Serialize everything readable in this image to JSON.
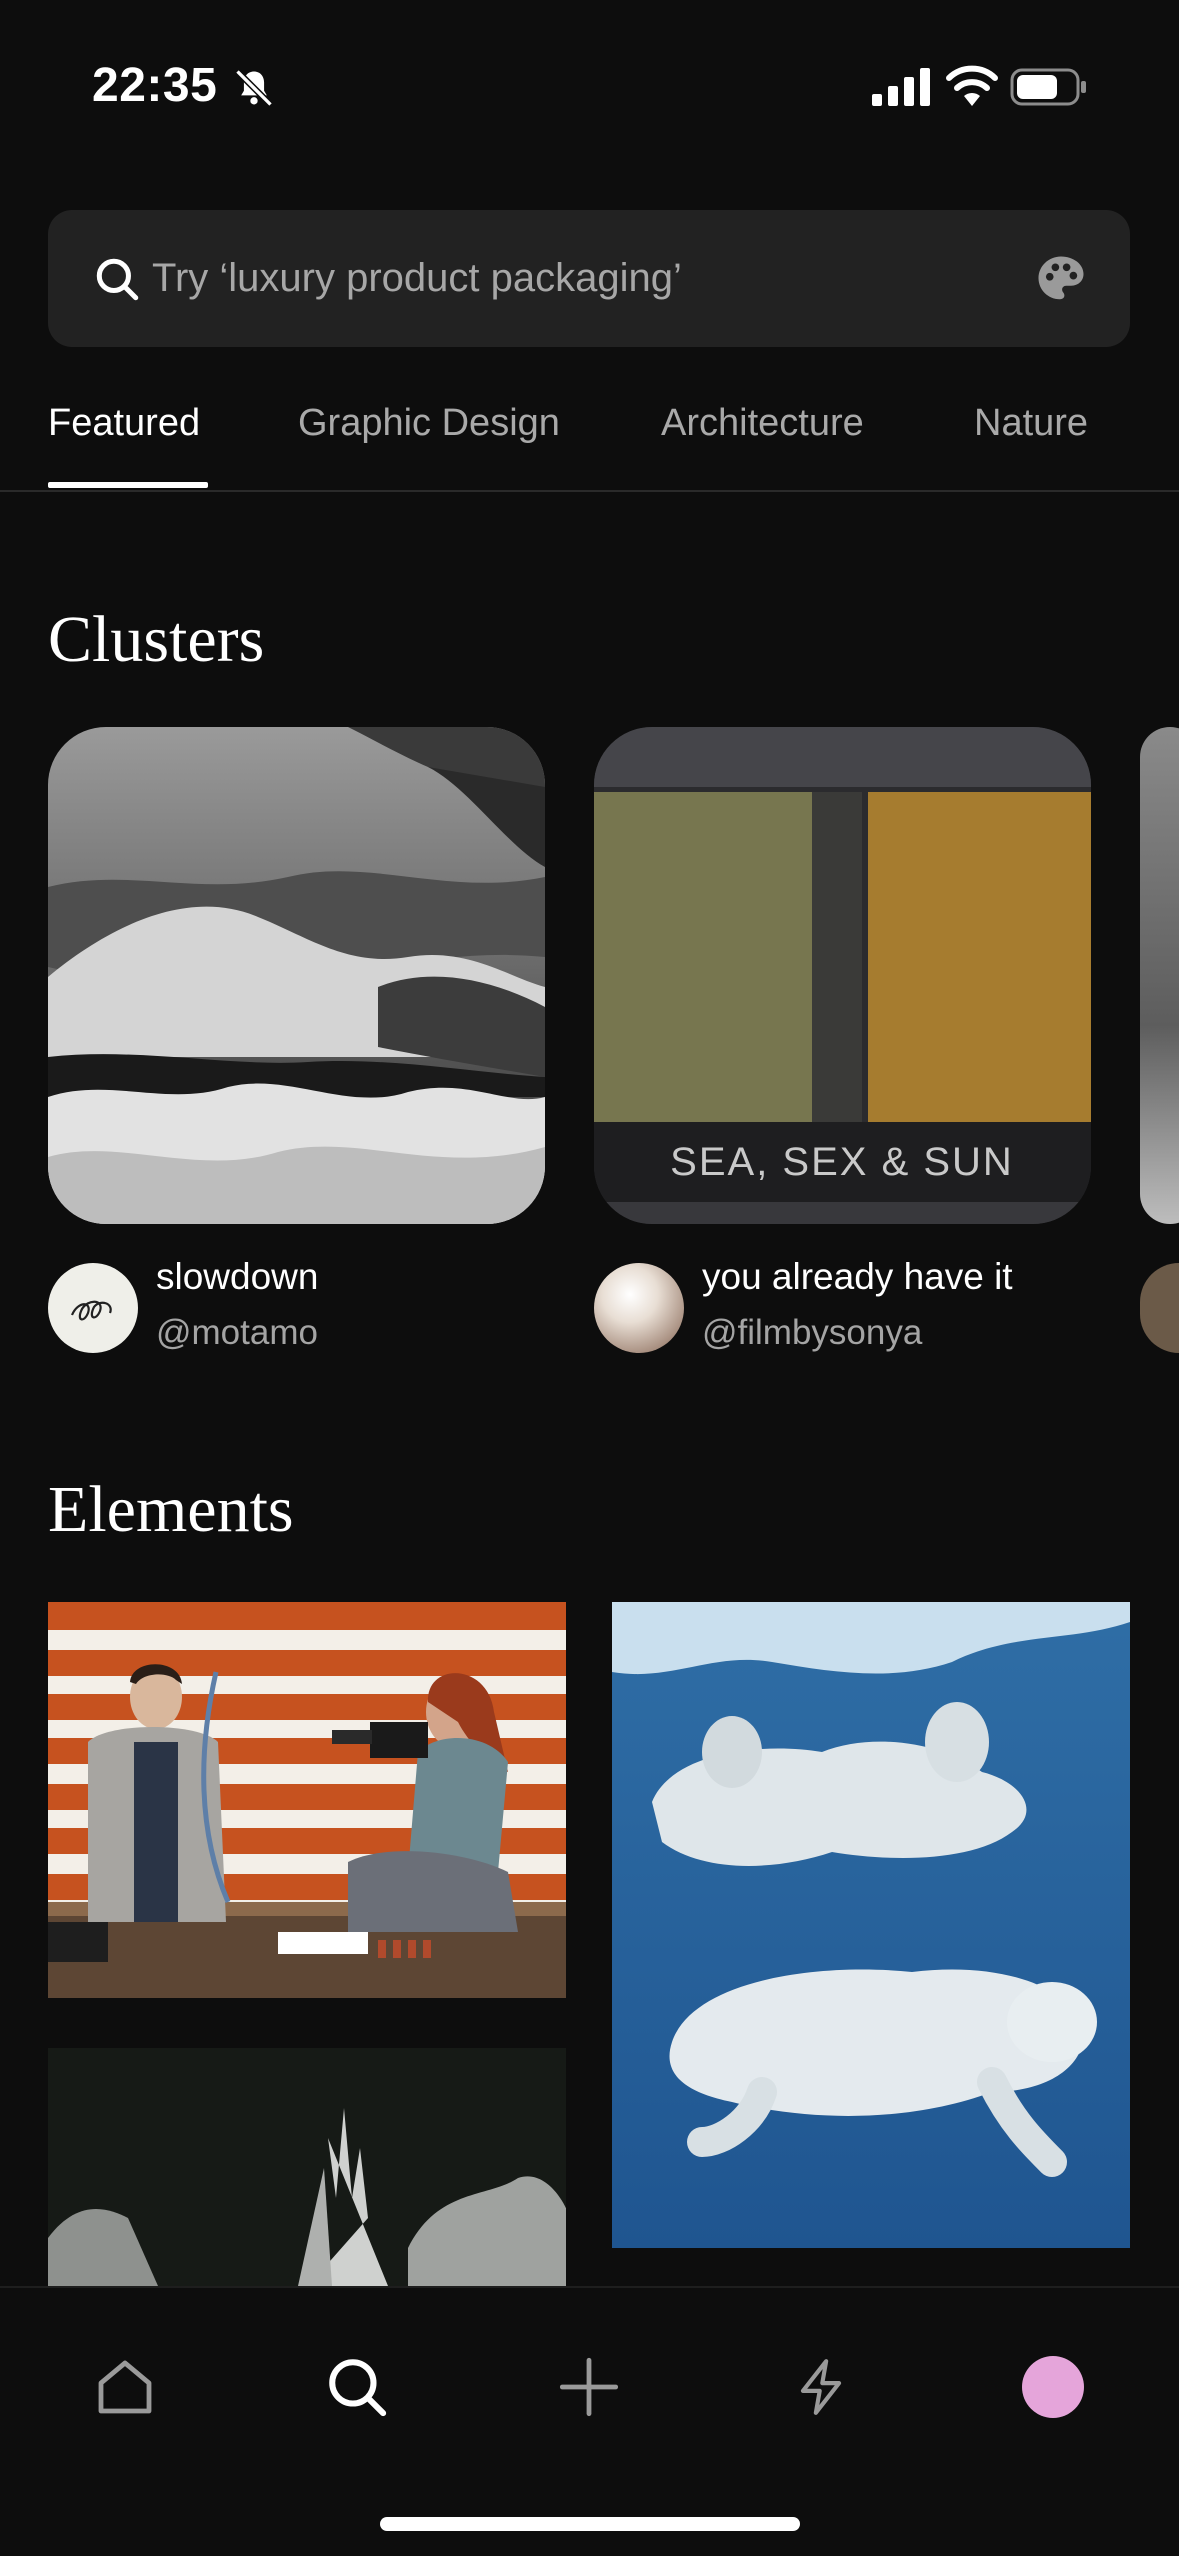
{
  "status_bar": {
    "time": "22:35"
  },
  "search": {
    "placeholder": "Try ‘luxury product packaging’"
  },
  "tabs": [
    {
      "label": "Featured",
      "active": true
    },
    {
      "label": "Graphic Design",
      "active": false
    },
    {
      "label": "Architecture",
      "active": false
    },
    {
      "label": "Nature",
      "active": false
    }
  ],
  "sections": {
    "clusters_title": "Clusters",
    "elements_title": "Elements"
  },
  "clusters": [
    {
      "title": "slowdown",
      "handle": "@motamo"
    },
    {
      "title": "you already have it",
      "handle": "@filmbysonya",
      "image_caption": "SEA, SEX & SUN"
    }
  ],
  "nav": {
    "items": [
      "home-icon",
      "search-icon",
      "plus-icon",
      "lightning-icon",
      "profile-avatar"
    ],
    "avatar_color": "#e5a5da"
  },
  "colors": {
    "background": "#0d0d0d",
    "search_bg": "#222222",
    "muted_text": "#a7a7a7"
  }
}
